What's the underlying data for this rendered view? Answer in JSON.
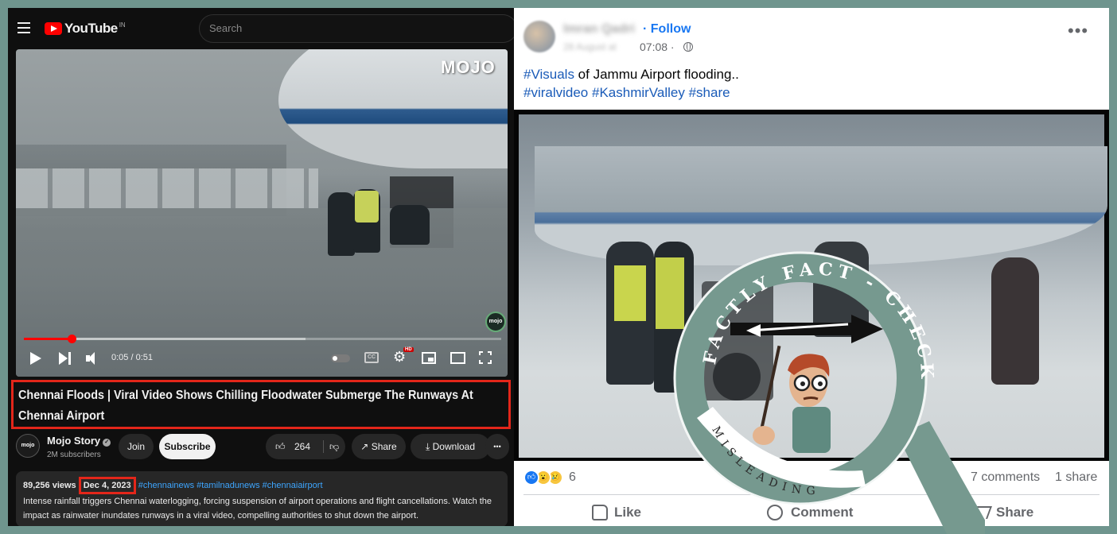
{
  "youtube": {
    "logo_text": "YouTube",
    "logo_country": "IN",
    "search_placeholder": "Search",
    "video": {
      "watermark": "MOJO",
      "corner_logo": "mojo",
      "time": "0:05 / 0:51",
      "progress_fraction": 0.1,
      "buffer_fraction": 0.59,
      "hd_badge": "HD",
      "cc_label": "CC"
    },
    "title": "Chennai Floods | Viral Video Shows Chilling Floodwater Submerge The Runways At Chennai Airport",
    "channel": {
      "avatar_text": "mojo",
      "name": "Mojo Story",
      "subscribers": "2M subscribers",
      "join_label": "Join",
      "subscribe_label": "Subscribe"
    },
    "actions": {
      "likes": "264",
      "share_label": "Share",
      "download_label": "Download",
      "more_label": "•••"
    },
    "description": {
      "views": "89,256 views",
      "date": "Dec 4, 2023",
      "tags": "#chennainews #tamilnadunews #chennaiairport",
      "text": "Intense rainfall triggers Chennai waterlogging, forcing suspension of airport operations and flight cancellations. Watch the impact as rainwater inundates runways in a viral video, compelling authorities to shut down the airport."
    }
  },
  "facebook": {
    "author": "Imran Qadri",
    "follow_label": "Follow",
    "date_blurred": "28 August at",
    "time": "07:08 ·",
    "more_label": "•••",
    "post_text": {
      "tag1": "#Visuals",
      "line1_rest": " of Jammu Airport flooding..",
      "tag2": "#viralvideo",
      "tag3": "#KashmirValley",
      "tag4": "#share"
    },
    "reaction_count": "6",
    "comments": "7 comments",
    "shares": "1 share",
    "like_label": "Like",
    "comment_label": "Comment",
    "share_label": "Share"
  },
  "stamp": {
    "ring_text": "FACTLY FACT - CHECK",
    "verdict": "MISLEADING",
    "ring_color": "#76998f",
    "handle_color": "#76998f"
  }
}
